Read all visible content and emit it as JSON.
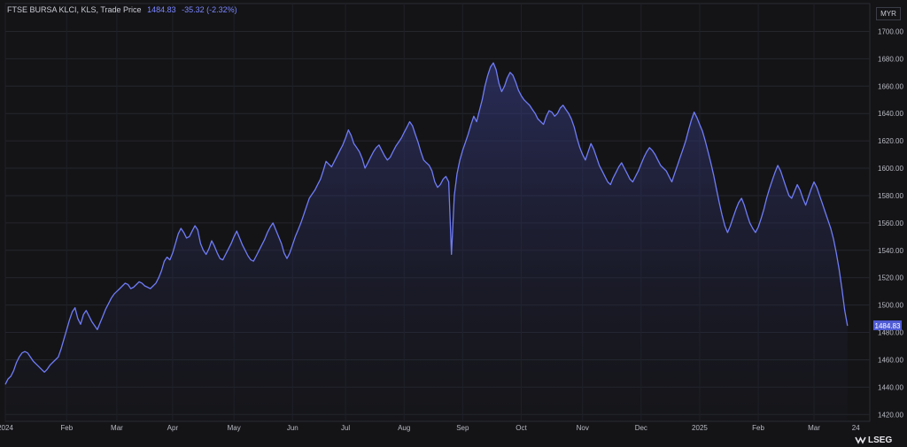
{
  "header": {
    "title": "FTSE BURSA KLCI, KLS,  Trade Price",
    "last_value": "1484.83",
    "change": "-35.32 (-2.32%)"
  },
  "currency": "MYR",
  "brand": "LSEG",
  "colors": {
    "line": "#6f7cf7",
    "accent": "#4f5bd5",
    "background": "#141417"
  },
  "chart_data": {
    "type": "area",
    "title": "FTSE BURSA KLCI",
    "ylabel": "",
    "xlabel": "",
    "ylim": [
      1415,
      1710
    ],
    "y_ticks": [
      1420,
      1440,
      1460,
      1480,
      1500,
      1520,
      1540,
      1560,
      1580,
      1600,
      1620,
      1640,
      1660,
      1680,
      1700
    ],
    "y_tick_labels": [
      "1420.00",
      "1440.00",
      "1460.00",
      "1480.00",
      "1500.00",
      "1520.00",
      "1540.00",
      "1560.00",
      "1580.00",
      "1600.00",
      "1620.00",
      "1640.00",
      "1660.00",
      "1680.00",
      "1700.00"
    ],
    "x_tick_labels": [
      "2024",
      "Feb",
      "Mar",
      "Apr",
      "May",
      "Jun",
      "Jul",
      "Aug",
      "Sep",
      "Oct",
      "Nov",
      "Dec",
      "2025",
      "Feb",
      "Mar",
      "24"
    ],
    "x_tick_index": [
      0,
      22,
      40,
      60,
      82,
      103,
      122,
      143,
      164,
      185,
      207,
      228,
      249,
      270,
      290,
      305
    ],
    "last_value_label": "1484.83",
    "values": [
      1442,
      1446,
      1448,
      1452,
      1458,
      1462,
      1465,
      1466,
      1465,
      1462,
      1459,
      1457,
      1455,
      1453,
      1451,
      1453,
      1456,
      1458,
      1460,
      1462,
      1468,
      1475,
      1482,
      1489,
      1495,
      1498,
      1490,
      1486,
      1493,
      1496,
      1492,
      1488,
      1485,
      1482,
      1487,
      1492,
      1497,
      1501,
      1505,
      1508,
      1510,
      1512,
      1514,
      1516,
      1515,
      1512,
      1513,
      1515,
      1517,
      1516,
      1514,
      1513,
      1512,
      1514,
      1516,
      1520,
      1525,
      1532,
      1535,
      1533,
      1538,
      1545,
      1552,
      1556,
      1553,
      1549,
      1550,
      1554,
      1558,
      1555,
      1545,
      1540,
      1537,
      1541,
      1547,
      1543,
      1538,
      1534,
      1533,
      1537,
      1541,
      1545,
      1550,
      1554,
      1549,
      1544,
      1540,
      1536,
      1533,
      1532,
      1536,
      1540,
      1544,
      1548,
      1553,
      1557,
      1560,
      1555,
      1550,
      1545,
      1538,
      1534,
      1538,
      1544,
      1550,
      1555,
      1560,
      1566,
      1572,
      1578,
      1581,
      1584,
      1588,
      1592,
      1598,
      1605,
      1603,
      1601,
      1605,
      1609,
      1613,
      1617,
      1622,
      1628,
      1624,
      1618,
      1615,
      1612,
      1607,
      1600,
      1604,
      1608,
      1612,
      1615,
      1617,
      1613,
      1609,
      1606,
      1608,
      1612,
      1616,
      1619,
      1622,
      1626,
      1630,
      1634,
      1631,
      1625,
      1619,
      1612,
      1606,
      1604,
      1602,
      1598,
      1590,
      1586,
      1588,
      1592,
      1594,
      1590,
      1537,
      1580,
      1596,
      1606,
      1613,
      1619,
      1625,
      1632,
      1638,
      1634,
      1642,
      1650,
      1660,
      1668,
      1674,
      1677,
      1672,
      1662,
      1656,
      1660,
      1666,
      1670,
      1668,
      1663,
      1657,
      1653,
      1650,
      1648,
      1646,
      1643,
      1640,
      1636,
      1634,
      1632,
      1638,
      1642,
      1641,
      1638,
      1640,
      1644,
      1646,
      1643,
      1640,
      1636,
      1630,
      1622,
      1615,
      1610,
      1606,
      1612,
      1618,
      1614,
      1608,
      1602,
      1598,
      1594,
      1590,
      1588,
      1593,
      1597,
      1601,
      1604,
      1600,
      1596,
      1592,
      1590,
      1594,
      1598,
      1603,
      1608,
      1612,
      1615,
      1613,
      1610,
      1606,
      1602,
      1600,
      1598,
      1594,
      1590,
      1596,
      1602,
      1608,
      1614,
      1620,
      1628,
      1635,
      1641,
      1637,
      1632,
      1627,
      1620,
      1612,
      1604,
      1595,
      1585,
      1575,
      1566,
      1558,
      1553,
      1558,
      1564,
      1570,
      1575,
      1578,
      1573,
      1566,
      1560,
      1556,
      1553,
      1557,
      1563,
      1570,
      1578,
      1585,
      1591,
      1597,
      1602,
      1598,
      1592,
      1586,
      1580,
      1578,
      1583,
      1588,
      1584,
      1578,
      1573,
      1579,
      1585,
      1590,
      1586,
      1580,
      1574,
      1568,
      1562,
      1556,
      1548,
      1538,
      1526,
      1512,
      1496,
      1484.83
    ]
  }
}
